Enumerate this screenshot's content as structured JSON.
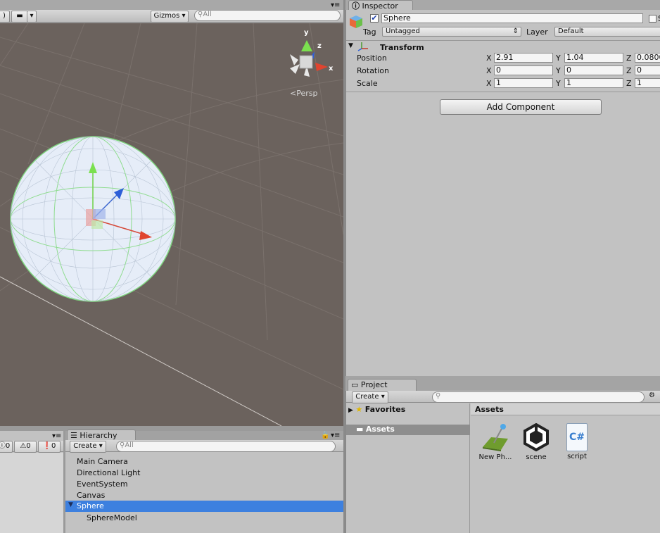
{
  "scene_toolbar": {
    "gizmos_label": "Gizmos",
    "search_placeholder": "All"
  },
  "scene_view": {
    "projection_label": "Persp",
    "axis_labels": {
      "y": "y",
      "z": "z",
      "x": "x"
    }
  },
  "inspector": {
    "tab_label": "Inspector",
    "object_name": "Sphere",
    "active": true,
    "tag_label": "Tag",
    "tag_value": "Untagged",
    "layer_label": "Layer",
    "layer_value": "Default",
    "static_label": "S",
    "transform": {
      "title": "Transform",
      "rows": [
        {
          "label": "Position",
          "x": "2.91",
          "y": "1.04",
          "z": "0.0800"
        },
        {
          "label": "Rotation",
          "x": "0",
          "y": "0",
          "z": "0"
        },
        {
          "label": "Scale",
          "x": "1",
          "y": "1",
          "z": "1"
        }
      ],
      "axis_x": "X",
      "axis_y": "Y",
      "axis_z": "Z"
    },
    "add_component_label": "Add Component"
  },
  "project": {
    "tab_label": "Project",
    "create_label": "Create",
    "favorites_label": "Favorites",
    "assets_folder_label": "Assets",
    "assets_header": "Assets",
    "assets": [
      {
        "name": "New Ph...",
        "icon": "physic-material-icon"
      },
      {
        "name": "scene",
        "icon": "unity-scene-icon"
      },
      {
        "name": "script",
        "icon": "csharp-script-icon"
      }
    ]
  },
  "console": {
    "log_count": "0",
    "warning_count": "0",
    "error_count": "0"
  },
  "hierarchy": {
    "tab_label": "Hierarchy",
    "create_label": "Create",
    "search_placeholder": "All",
    "items": [
      {
        "label": "Main Camera"
      },
      {
        "label": "Directional Light"
      },
      {
        "label": "EventSystem"
      },
      {
        "label": "Canvas"
      },
      {
        "label": "Sphere"
      },
      {
        "label": "SphereModel"
      }
    ]
  },
  "colors": {
    "scene_bg": "#6b625d",
    "panel_bg": "#c2c2c2",
    "selection": "#3d80df"
  }
}
